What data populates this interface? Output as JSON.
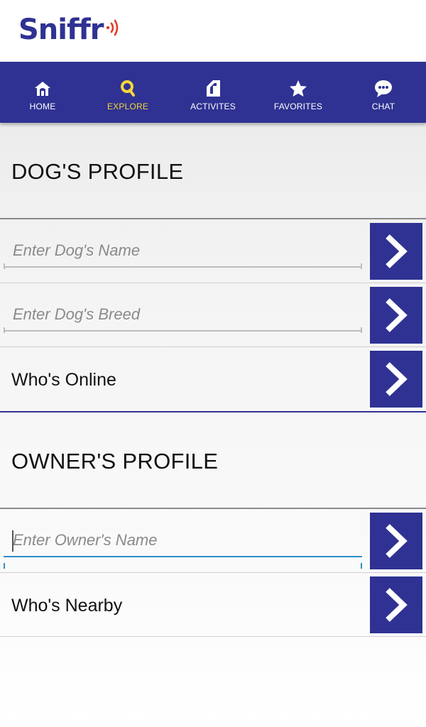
{
  "app": {
    "logo": "Sniffr"
  },
  "nav": {
    "items": [
      {
        "label": "HOME",
        "icon": "home-icon",
        "active": false
      },
      {
        "label": "EXPLORE",
        "icon": "search-icon",
        "active": true
      },
      {
        "label": "ACTIVITES",
        "icon": "activities-icon",
        "active": false
      },
      {
        "label": "FAVORITES",
        "icon": "star-icon",
        "active": false
      },
      {
        "label": "CHAT",
        "icon": "chat-icon",
        "active": false
      }
    ]
  },
  "dog_profile": {
    "title": "DOG'S PROFILE",
    "name_placeholder": "Enter Dog's Name",
    "breed_placeholder": "Enter Dog's Breed",
    "whos_online": "Who's Online"
  },
  "owner_profile": {
    "title": "OWNER'S PROFILE",
    "name_placeholder": "Enter Owner's Name",
    "whos_nearby": "Who's Nearby"
  },
  "colors": {
    "brand": "#2f3292",
    "active_nav": "#f7d53a",
    "focus": "#2d8fc9"
  }
}
